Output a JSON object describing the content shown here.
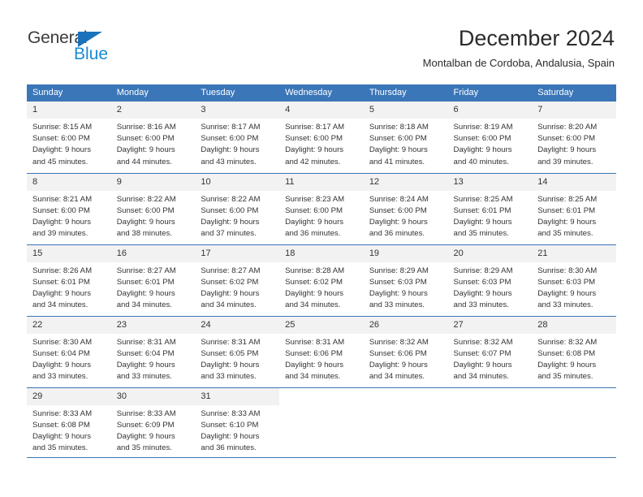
{
  "logo": {
    "word_top": "General",
    "word_bottom": "Blue",
    "triangle_color": "#1a72ba",
    "top_color": "#3b3b3b",
    "bottom_color": "#1a8ad4"
  },
  "header": {
    "title": "December 2024",
    "subtitle": "Montalban de Cordoba, Andalusia, Spain"
  },
  "theme": {
    "accent": "#3a76b8",
    "daynum_bg": "#f2f2f2",
    "text": "#333333"
  },
  "calendar": {
    "weekday_headers": [
      "Sunday",
      "Monday",
      "Tuesday",
      "Wednesday",
      "Thursday",
      "Friday",
      "Saturday"
    ],
    "weeks": [
      [
        {
          "day": "1",
          "sunrise": "Sunrise: 8:15 AM",
          "sunset": "Sunset: 6:00 PM",
          "daylight_1": "Daylight: 9 hours",
          "daylight_2": "and 45 minutes."
        },
        {
          "day": "2",
          "sunrise": "Sunrise: 8:16 AM",
          "sunset": "Sunset: 6:00 PM",
          "daylight_1": "Daylight: 9 hours",
          "daylight_2": "and 44 minutes."
        },
        {
          "day": "3",
          "sunrise": "Sunrise: 8:17 AM",
          "sunset": "Sunset: 6:00 PM",
          "daylight_1": "Daylight: 9 hours",
          "daylight_2": "and 43 minutes."
        },
        {
          "day": "4",
          "sunrise": "Sunrise: 8:17 AM",
          "sunset": "Sunset: 6:00 PM",
          "daylight_1": "Daylight: 9 hours",
          "daylight_2": "and 42 minutes."
        },
        {
          "day": "5",
          "sunrise": "Sunrise: 8:18 AM",
          "sunset": "Sunset: 6:00 PM",
          "daylight_1": "Daylight: 9 hours",
          "daylight_2": "and 41 minutes."
        },
        {
          "day": "6",
          "sunrise": "Sunrise: 8:19 AM",
          "sunset": "Sunset: 6:00 PM",
          "daylight_1": "Daylight: 9 hours",
          "daylight_2": "and 40 minutes."
        },
        {
          "day": "7",
          "sunrise": "Sunrise: 8:20 AM",
          "sunset": "Sunset: 6:00 PM",
          "daylight_1": "Daylight: 9 hours",
          "daylight_2": "and 39 minutes."
        }
      ],
      [
        {
          "day": "8",
          "sunrise": "Sunrise: 8:21 AM",
          "sunset": "Sunset: 6:00 PM",
          "daylight_1": "Daylight: 9 hours",
          "daylight_2": "and 39 minutes."
        },
        {
          "day": "9",
          "sunrise": "Sunrise: 8:22 AM",
          "sunset": "Sunset: 6:00 PM",
          "daylight_1": "Daylight: 9 hours",
          "daylight_2": "and 38 minutes."
        },
        {
          "day": "10",
          "sunrise": "Sunrise: 8:22 AM",
          "sunset": "Sunset: 6:00 PM",
          "daylight_1": "Daylight: 9 hours",
          "daylight_2": "and 37 minutes."
        },
        {
          "day": "11",
          "sunrise": "Sunrise: 8:23 AM",
          "sunset": "Sunset: 6:00 PM",
          "daylight_1": "Daylight: 9 hours",
          "daylight_2": "and 36 minutes."
        },
        {
          "day": "12",
          "sunrise": "Sunrise: 8:24 AM",
          "sunset": "Sunset: 6:00 PM",
          "daylight_1": "Daylight: 9 hours",
          "daylight_2": "and 36 minutes."
        },
        {
          "day": "13",
          "sunrise": "Sunrise: 8:25 AM",
          "sunset": "Sunset: 6:01 PM",
          "daylight_1": "Daylight: 9 hours",
          "daylight_2": "and 35 minutes."
        },
        {
          "day": "14",
          "sunrise": "Sunrise: 8:25 AM",
          "sunset": "Sunset: 6:01 PM",
          "daylight_1": "Daylight: 9 hours",
          "daylight_2": "and 35 minutes."
        }
      ],
      [
        {
          "day": "15",
          "sunrise": "Sunrise: 8:26 AM",
          "sunset": "Sunset: 6:01 PM",
          "daylight_1": "Daylight: 9 hours",
          "daylight_2": "and 34 minutes."
        },
        {
          "day": "16",
          "sunrise": "Sunrise: 8:27 AM",
          "sunset": "Sunset: 6:01 PM",
          "daylight_1": "Daylight: 9 hours",
          "daylight_2": "and 34 minutes."
        },
        {
          "day": "17",
          "sunrise": "Sunrise: 8:27 AM",
          "sunset": "Sunset: 6:02 PM",
          "daylight_1": "Daylight: 9 hours",
          "daylight_2": "and 34 minutes."
        },
        {
          "day": "18",
          "sunrise": "Sunrise: 8:28 AM",
          "sunset": "Sunset: 6:02 PM",
          "daylight_1": "Daylight: 9 hours",
          "daylight_2": "and 34 minutes."
        },
        {
          "day": "19",
          "sunrise": "Sunrise: 8:29 AM",
          "sunset": "Sunset: 6:03 PM",
          "daylight_1": "Daylight: 9 hours",
          "daylight_2": "and 33 minutes."
        },
        {
          "day": "20",
          "sunrise": "Sunrise: 8:29 AM",
          "sunset": "Sunset: 6:03 PM",
          "daylight_1": "Daylight: 9 hours",
          "daylight_2": "and 33 minutes."
        },
        {
          "day": "21",
          "sunrise": "Sunrise: 8:30 AM",
          "sunset": "Sunset: 6:03 PM",
          "daylight_1": "Daylight: 9 hours",
          "daylight_2": "and 33 minutes."
        }
      ],
      [
        {
          "day": "22",
          "sunrise": "Sunrise: 8:30 AM",
          "sunset": "Sunset: 6:04 PM",
          "daylight_1": "Daylight: 9 hours",
          "daylight_2": "and 33 minutes."
        },
        {
          "day": "23",
          "sunrise": "Sunrise: 8:31 AM",
          "sunset": "Sunset: 6:04 PM",
          "daylight_1": "Daylight: 9 hours",
          "daylight_2": "and 33 minutes."
        },
        {
          "day": "24",
          "sunrise": "Sunrise: 8:31 AM",
          "sunset": "Sunset: 6:05 PM",
          "daylight_1": "Daylight: 9 hours",
          "daylight_2": "and 33 minutes."
        },
        {
          "day": "25",
          "sunrise": "Sunrise: 8:31 AM",
          "sunset": "Sunset: 6:06 PM",
          "daylight_1": "Daylight: 9 hours",
          "daylight_2": "and 34 minutes."
        },
        {
          "day": "26",
          "sunrise": "Sunrise: 8:32 AM",
          "sunset": "Sunset: 6:06 PM",
          "daylight_1": "Daylight: 9 hours",
          "daylight_2": "and 34 minutes."
        },
        {
          "day": "27",
          "sunrise": "Sunrise: 8:32 AM",
          "sunset": "Sunset: 6:07 PM",
          "daylight_1": "Daylight: 9 hours",
          "daylight_2": "and 34 minutes."
        },
        {
          "day": "28",
          "sunrise": "Sunrise: 8:32 AM",
          "sunset": "Sunset: 6:08 PM",
          "daylight_1": "Daylight: 9 hours",
          "daylight_2": "and 35 minutes."
        }
      ],
      [
        {
          "day": "29",
          "sunrise": "Sunrise: 8:33 AM",
          "sunset": "Sunset: 6:08 PM",
          "daylight_1": "Daylight: 9 hours",
          "daylight_2": "and 35 minutes."
        },
        {
          "day": "30",
          "sunrise": "Sunrise: 8:33 AM",
          "sunset": "Sunset: 6:09 PM",
          "daylight_1": "Daylight: 9 hours",
          "daylight_2": "and 35 minutes."
        },
        {
          "day": "31",
          "sunrise": "Sunrise: 8:33 AM",
          "sunset": "Sunset: 6:10 PM",
          "daylight_1": "Daylight: 9 hours",
          "daylight_2": "and 36 minutes."
        },
        {
          "day": "",
          "sunrise": "",
          "sunset": "",
          "daylight_1": "",
          "daylight_2": ""
        },
        {
          "day": "",
          "sunrise": "",
          "sunset": "",
          "daylight_1": "",
          "daylight_2": ""
        },
        {
          "day": "",
          "sunrise": "",
          "sunset": "",
          "daylight_1": "",
          "daylight_2": ""
        },
        {
          "day": "",
          "sunrise": "",
          "sunset": "",
          "daylight_1": "",
          "daylight_2": ""
        }
      ]
    ]
  }
}
